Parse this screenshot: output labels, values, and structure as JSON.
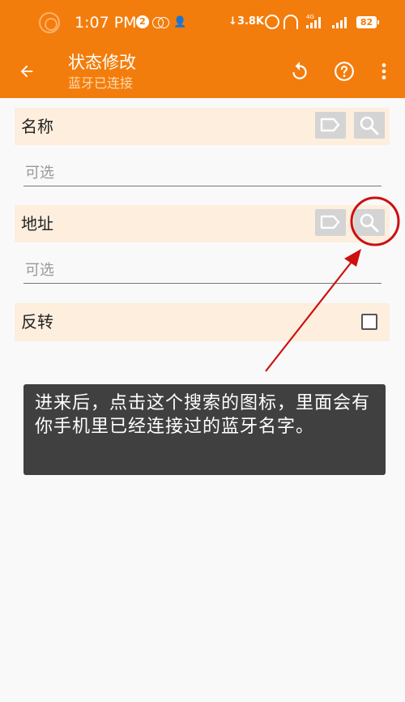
{
  "status_bar": {
    "time": "1:07 PM",
    "notification_count": "2",
    "network_speed": "↓3.8K",
    "network_type": "4G",
    "battery": "82"
  },
  "app_bar": {
    "title": "状态修改",
    "subtitle": "蓝牙已连接",
    "icons": [
      "back-arrow-icon",
      "refresh-icon",
      "help-icon",
      "more-vert-icon"
    ]
  },
  "form": {
    "name": {
      "label": "名称",
      "placeholder": "可选",
      "value": ""
    },
    "address": {
      "label": "地址",
      "placeholder": "可选",
      "value": ""
    },
    "invert": {
      "label": "反转",
      "checked": false
    }
  },
  "tooltip": {
    "text": "进来后，点击这个搜索的图标，里面会有你手机里已经连接过的蓝牙名字。"
  },
  "colors": {
    "accent": "#f37d0c",
    "row_background": "#fdeedd",
    "annotation": "#cc1010",
    "tooltip_background": "#404040"
  }
}
